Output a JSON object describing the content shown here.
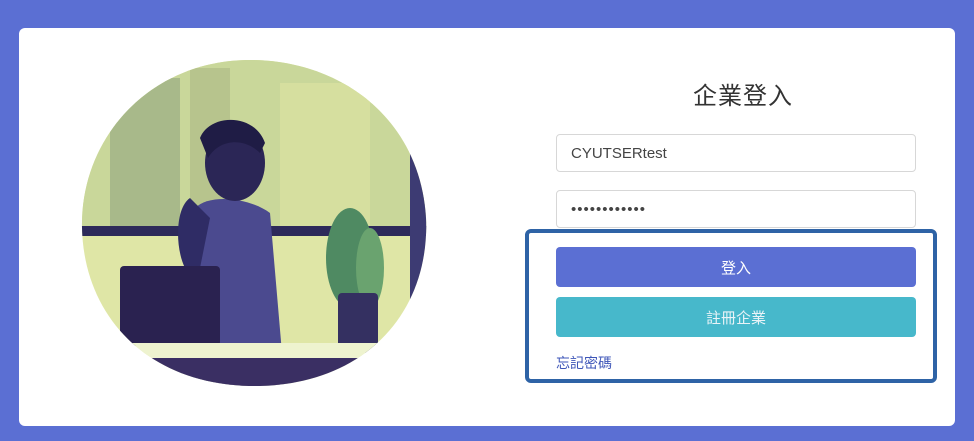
{
  "login": {
    "title": "企業登入",
    "username_value": "CYUTSERtest",
    "password_value": "••••••••••••",
    "login_label": "登入",
    "register_label": "註冊企業",
    "forgot_label": "忘記密碼"
  },
  "colors": {
    "background": "#5b6fd3",
    "login_button": "#5b6fd3",
    "register_button": "#47b8cb",
    "highlight_border": "#2e63a6",
    "link": "#3e56b8"
  },
  "illustration": {
    "icon": "person-at-laptop-illustration"
  }
}
